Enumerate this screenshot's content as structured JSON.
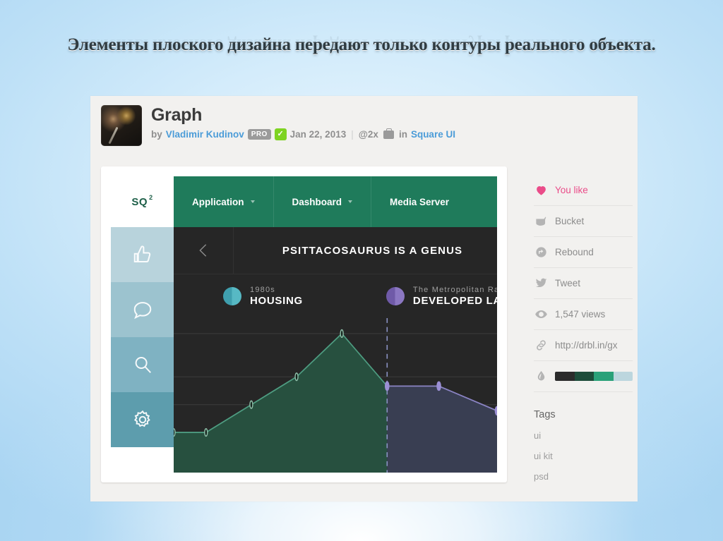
{
  "slide": {
    "title": "Элементы плоского дизайна передают только контуры реального объекта."
  },
  "shot": {
    "title": "Graph",
    "by_label": "by",
    "author": "Vladimir Kudinov",
    "pro_badge": "PRO",
    "verified_glyph": "✓",
    "date": "Jan 22, 2013",
    "separator": "|",
    "retina": "@2x",
    "in_label": "in",
    "project": "Square UI"
  },
  "mockup": {
    "logo": "SQ",
    "logo_sup": "2",
    "nav": [
      {
        "label": "Application",
        "has_caret": true
      },
      {
        "label": "Dashboard",
        "has_caret": true
      },
      {
        "label": "Media Server",
        "has_caret": false
      }
    ],
    "rail": [
      {
        "icon": "thumbs-up-icon",
        "color": "#b8d3dc"
      },
      {
        "icon": "comment-icon",
        "color": "#9cc3cf"
      },
      {
        "icon": "search-icon",
        "color": "#7fb2c2"
      },
      {
        "icon": "gear-icon",
        "color": "#5d9dad"
      }
    ],
    "hero_title": "PSITTACOSAURUS IS A GENUS",
    "legend": [
      {
        "marker": "teal",
        "sub": "1980s",
        "main": "HOUSING"
      },
      {
        "marker": "purple",
        "sub": "The Metropolitan Railw",
        "main": "DEVELOPED LAND"
      }
    ]
  },
  "chart_data": {
    "type": "area",
    "title": "Graph",
    "xlabel": "",
    "ylabel": "",
    "grid": true,
    "legend_position": "top",
    "axis_hidden": true,
    "ylim": [
      0,
      100
    ],
    "xlim": [
      0,
      10
    ],
    "divider_x": 6.6,
    "divider_style": "dashed",
    "series": [
      {
        "name": "HOUSING",
        "marker": "teal",
        "line_color": "#4e9c81",
        "fill_color": "#27503f",
        "x": [
          0.0,
          1.0,
          2.4,
          3.8,
          5.2,
          6.6
        ],
        "y": [
          26,
          26,
          44,
          62,
          90,
          56
        ]
      },
      {
        "name": "DEVELOPED LAND",
        "marker": "purple",
        "line_color": "#8b84c4",
        "fill_color": "#393e52",
        "x": [
          6.6,
          8.2,
          10.0
        ],
        "y": [
          56,
          56,
          40
        ]
      }
    ],
    "gridline_values": [
      26,
      44,
      62,
      90
    ]
  },
  "sidebar": {
    "rows": [
      {
        "icon": "heart-icon",
        "label": "You like",
        "accent": "#ea4c89"
      },
      {
        "icon": "bucket-icon",
        "label": "Bucket",
        "accent": "#8c8c8c"
      },
      {
        "icon": "rebound-icon",
        "label": "Rebound",
        "accent": "#8c8c8c"
      },
      {
        "icon": "twitter-bird-icon",
        "label": "Tweet",
        "accent": "#8c8c8c"
      },
      {
        "icon": "eye-icon",
        "label": "1,547 views",
        "accent": "#8c8c8c"
      },
      {
        "icon": "link-icon",
        "label": "http://drbl.in/gx",
        "accent": "#8c8c8c"
      },
      {
        "icon": "droplet-icon",
        "label": "",
        "accent": "#8c8c8c"
      }
    ],
    "palette": [
      "#2b2b2b",
      "#1d4c3a",
      "#2aa179",
      "#bcd6de"
    ],
    "tags_heading": "Tags",
    "tags": [
      "ui",
      "ui kit",
      "psd"
    ]
  },
  "colors": {
    "nav_green": "#1f7b5b",
    "dark_bg": "#262626",
    "area_green": "#27503f",
    "area_purple": "#393e52",
    "like_pink": "#ea4c89",
    "link_blue": "#4b9cd8"
  }
}
